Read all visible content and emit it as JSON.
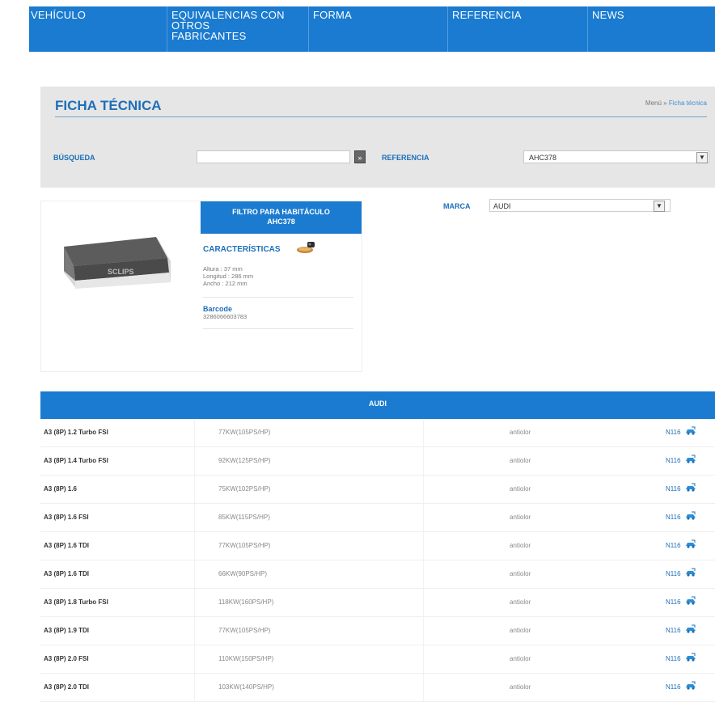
{
  "nav": {
    "items": [
      {
        "label": "VEHÍCULO"
      },
      {
        "label": "EQUIVALENCIAS CON OTROS FABRICANTES"
      },
      {
        "label": "FORMA"
      },
      {
        "label": "REFERENCIA"
      },
      {
        "label": "NEWS"
      }
    ]
  },
  "ficha": {
    "title": "FICHA TÉCNICA",
    "breadcrumb": {
      "home": "Menú",
      "separator": "»",
      "current": "Ficha técnica"
    },
    "busqueda_label": "BÚSQUEDA",
    "search_value": "",
    "search_button": "»",
    "referencia_label": "REFERENCIA",
    "referencia_value": "AHC378"
  },
  "product": {
    "header_line1": "FILTRO PARA HABITÁCULO",
    "header_line2": "AHC378",
    "caracteristicas_title": "CARACTERÍSTICAS",
    "specs": [
      "Altura : 37 mm",
      "Longitud : 286 mm",
      "Ancho : 212 mm"
    ],
    "barcode_label": "Barcode",
    "barcode_value": "3286066603783",
    "image_label": "SCLIPS"
  },
  "marca": {
    "label": "MARCA",
    "value": "AUDI"
  },
  "table": {
    "header": "AUDI",
    "rows": [
      {
        "model": "A3 (8P) 1.2 Turbo FSI",
        "power": "77KW(105PS/HP)",
        "type": "antiolor",
        "link": "N116"
      },
      {
        "model": "A3 (8P) 1.4 Turbo FSI",
        "power": "92KW(125PS/HP)",
        "type": "antiolor",
        "link": "N116"
      },
      {
        "model": "A3 (8P) 1.6",
        "power": "75KW(102PS/HP)",
        "type": "antiolor",
        "link": "N116"
      },
      {
        "model": "A3 (8P) 1.6 FSI",
        "power": "85KW(115PS/HP)",
        "type": "antiolor",
        "link": "N116"
      },
      {
        "model": "A3 (8P) 1.6 TDI",
        "power": "77KW(105PS/HP)",
        "type": "antiolor",
        "link": "N116"
      },
      {
        "model": "A3 (8P) 1.6 TDI",
        "power": "66KW(90PS/HP)",
        "type": "antiolor",
        "link": "N116"
      },
      {
        "model": "A3 (8P) 1.8 Turbo FSI",
        "power": "118KW(160PS/HP)",
        "type": "antiolor",
        "link": "N116"
      },
      {
        "model": "A3 (8P) 1.9 TDI",
        "power": "77KW(105PS/HP)",
        "type": "antiolor",
        "link": "N116"
      },
      {
        "model": "A3 (8P) 2.0 FSI",
        "power": "110KW(150PS/HP)",
        "type": "antiolor",
        "link": "N116"
      },
      {
        "model": "A3 (8P) 2.0 TDI",
        "power": "103KW(140PS/HP)",
        "type": "antiolor",
        "link": "N116"
      }
    ]
  },
  "icons": {
    "search_button": "arrow-right-icon",
    "dropdown": "chevron-down-icon",
    "car": "car-icon",
    "link": "car-link-icon"
  },
  "colors": {
    "brand_blue": "#1a7bd0",
    "title_blue": "#1d6fb8",
    "panel_gray": "#e6e6e6"
  }
}
